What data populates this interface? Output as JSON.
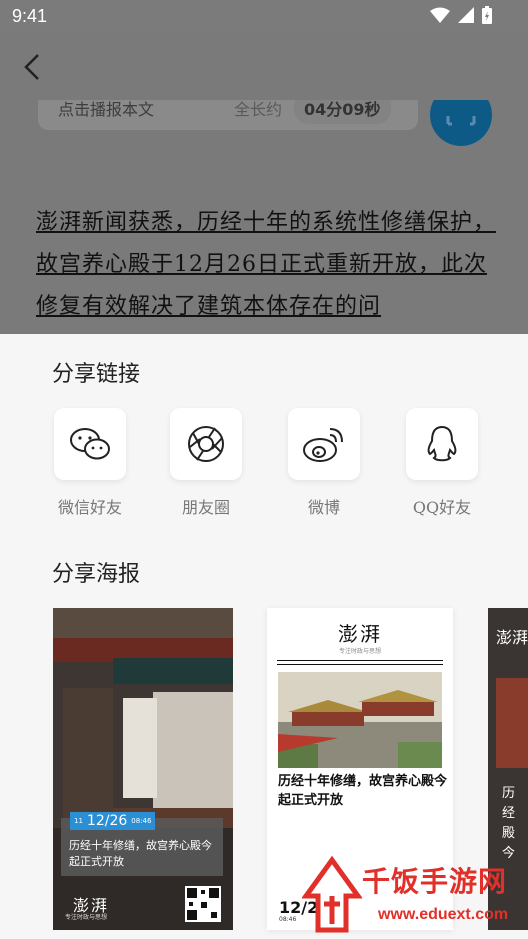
{
  "status_bar": {
    "time": "9:41"
  },
  "article": {
    "audio": {
      "label": "点击播报本文",
      "total_label": "全长约",
      "duration": "04分09秒"
    },
    "body_text": "澎湃新闻获悉，历经十年的系统性修缮保护，故宫养心殿于12月26日正式重新开放，此次修复有效解决了建筑本体存在的问"
  },
  "share_links": {
    "title": "分享链接",
    "items": [
      {
        "label": "微信好友",
        "icon": "wechat-icon"
      },
      {
        "label": "朋友圈",
        "icon": "moments-icon"
      },
      {
        "label": "微博",
        "icon": "weibo-icon"
      },
      {
        "label": "QQ好友",
        "icon": "qq-icon"
      }
    ]
  },
  "share_poster": {
    "title": "分享海报",
    "posters": [
      {
        "date": "12/26",
        "date_small": "08:46",
        "date_tag": "11",
        "headline": "历经十年修缮，故宫养心殿今起正式开放",
        "logo": "澎湃",
        "slogan": "专注时政与思想"
      },
      {
        "logo": "澎湃",
        "slogan": "专注时政与思想",
        "headline": "历经十年修缮，故宫养心殿今起正式开放",
        "date": "12/2",
        "date_small": "08:46"
      },
      {
        "logo": "澎湃",
        "headline": "历经殿今"
      }
    ]
  },
  "watermark": {
    "text": "千饭手游网",
    "url": "www.eduext.com"
  },
  "colors": {
    "accent": "#2a8fd4",
    "watermark": "#e1302a",
    "overlay": "#7a7a7a"
  }
}
